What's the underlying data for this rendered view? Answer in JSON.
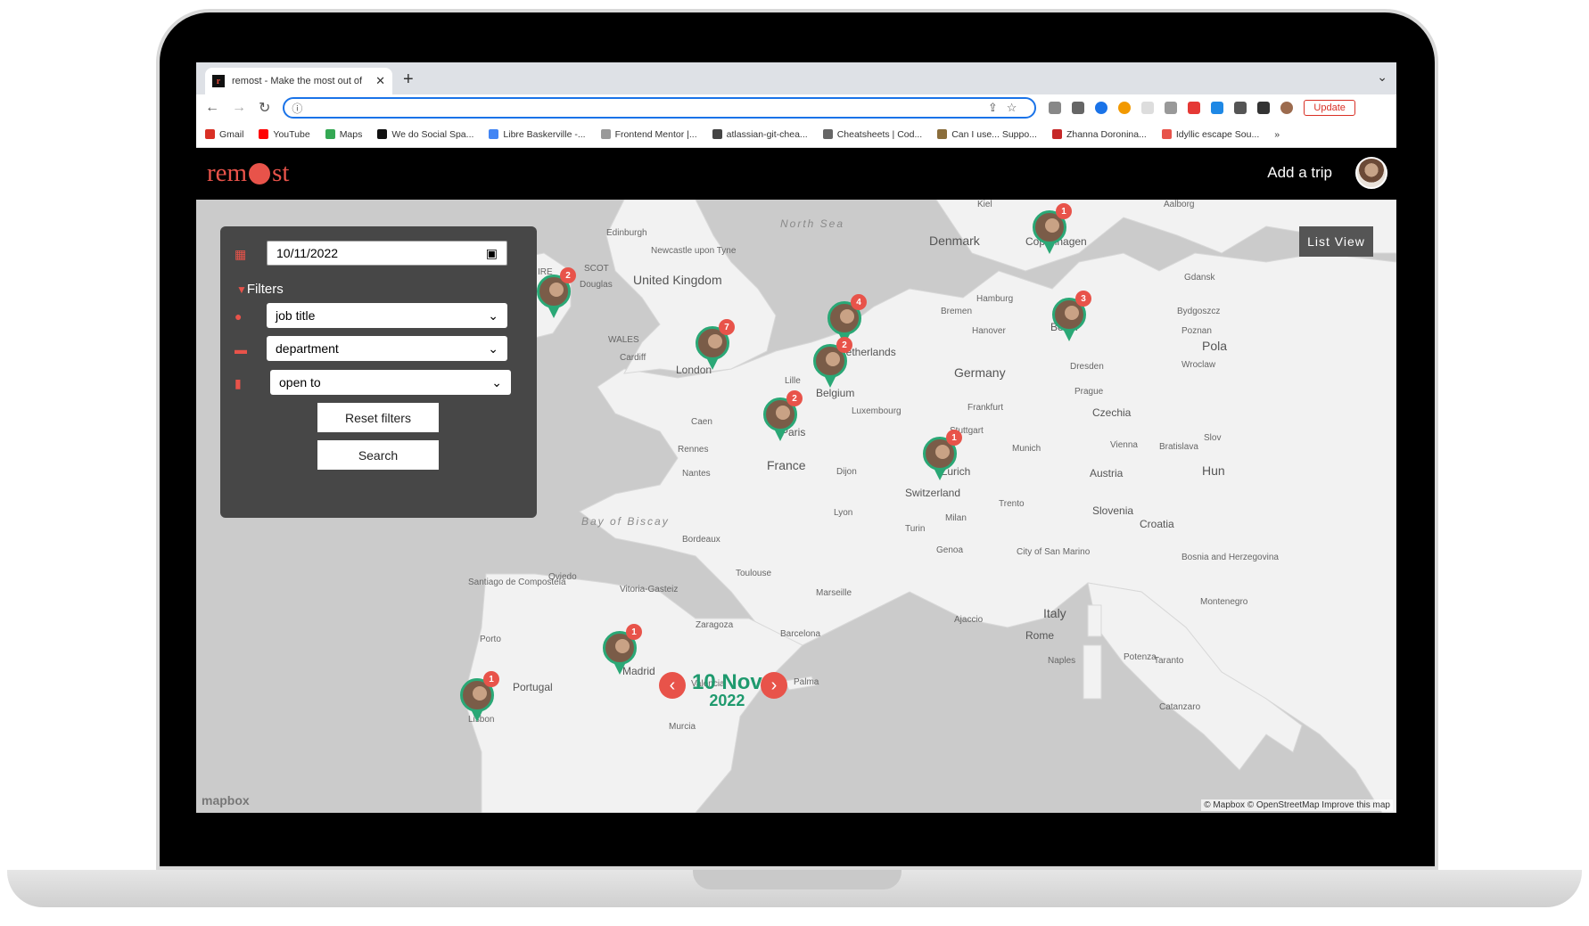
{
  "browser": {
    "tab_title": "remost - Make the most out of",
    "new_tab": "+",
    "update_label": "Update",
    "bookmarks": [
      "Gmail",
      "YouTube",
      "Maps",
      "We do Social Spa...",
      "Libre Baskerville -...",
      "Frontend Mentor |...",
      "atlassian-git-chea...",
      "Cheatsheets | Cod...",
      "Can I use... Suppo...",
      "Zhanna Doronina...",
      "Idyllic escape Sou..."
    ],
    "bookmark_colors": [
      "#d93025",
      "#ff0000",
      "#34a853",
      "#111111",
      "#4285f4",
      "#999999",
      "#444444",
      "#666666",
      "#8a6d3b",
      "#c62828",
      "#e8534a"
    ]
  },
  "app": {
    "logo_left": "rem",
    "logo_right": "st",
    "add_trip": "Add a trip",
    "list_view": "List View"
  },
  "filters": {
    "date_value": "10/11/2022",
    "heading": "Filters",
    "job_title": "job title",
    "department": "department",
    "open_to": "open to",
    "reset": "Reset filters",
    "search": "Search"
  },
  "map": {
    "labels": [
      {
        "t": "North Sea",
        "c": "sea"
      },
      {
        "t": "Denmark",
        "c": "big"
      },
      {
        "t": "United Kingdom",
        "c": "big"
      },
      {
        "t": "Ireland",
        "c": "big"
      },
      {
        "t": "Edinburgh",
        "c": "sm"
      },
      {
        "t": "Newcastle upon Tyne",
        "c": "sm"
      },
      {
        "t": "Douglas",
        "c": "sm"
      },
      {
        "t": "WALES",
        "c": "sm"
      },
      {
        "t": "Cardiff",
        "c": "sm"
      },
      {
        "t": "London",
        "c": ""
      },
      {
        "t": "Lille",
        "c": "sm"
      },
      {
        "t": "Belgium",
        "c": ""
      },
      {
        "t": "Luxembourg",
        "c": "sm"
      },
      {
        "t": "Paris",
        "c": ""
      },
      {
        "t": "Caen",
        "c": "sm"
      },
      {
        "t": "Rennes",
        "c": "sm"
      },
      {
        "t": "Nantes",
        "c": "sm"
      },
      {
        "t": "France",
        "c": "big"
      },
      {
        "t": "Dijon",
        "c": "sm"
      },
      {
        "t": "Lyon",
        "c": "sm"
      },
      {
        "t": "Bordeaux",
        "c": "sm"
      },
      {
        "t": "Toulouse",
        "c": "sm"
      },
      {
        "t": "Marseille",
        "c": "sm"
      },
      {
        "t": "Bay of Biscay",
        "c": "sea"
      },
      {
        "t": "Germany",
        "c": "big"
      },
      {
        "t": "Hamburg",
        "c": "sm"
      },
      {
        "t": "Bremen",
        "c": "sm"
      },
      {
        "t": "Hanover",
        "c": "sm"
      },
      {
        "t": "Berlin",
        "c": ""
      },
      {
        "t": "Frankfurt",
        "c": "sm"
      },
      {
        "t": "Stuttgart",
        "c": "sm"
      },
      {
        "t": "Munich",
        "c": "sm"
      },
      {
        "t": "Zurich",
        "c": ""
      },
      {
        "t": "Switzerland",
        "c": ""
      },
      {
        "t": "Dresden",
        "c": "sm"
      },
      {
        "t": "Prague",
        "c": "sm"
      },
      {
        "t": "Czechia",
        "c": ""
      },
      {
        "t": "Vienna",
        "c": "sm"
      },
      {
        "t": "Austria",
        "c": ""
      },
      {
        "t": "Bratislava",
        "c": "sm"
      },
      {
        "t": "Slovenia",
        "c": ""
      },
      {
        "t": "Croatia",
        "c": ""
      },
      {
        "t": "Trento",
        "c": "sm"
      },
      {
        "t": "Milan",
        "c": "sm"
      },
      {
        "t": "Turin",
        "c": "sm"
      },
      {
        "t": "Genoa",
        "c": "sm"
      },
      {
        "t": "Italy",
        "c": "big"
      },
      {
        "t": "Rome",
        "c": ""
      },
      {
        "t": "Naples",
        "c": "sm"
      },
      {
        "t": "Potenza",
        "c": "sm"
      },
      {
        "t": "Taranto",
        "c": "sm"
      },
      {
        "t": "Catanzaro",
        "c": "sm"
      },
      {
        "t": "Ajaccio",
        "c": "sm"
      },
      {
        "t": "City of San Marino",
        "c": "sm"
      },
      {
        "t": "Bosnia and Herzegovina",
        "c": "sm"
      },
      {
        "t": "Montenegro",
        "c": "sm"
      },
      {
        "t": "Kiel",
        "c": "sm"
      },
      {
        "t": "Gdansk",
        "c": "sm"
      },
      {
        "t": "Bydgoszcz",
        "c": "sm"
      },
      {
        "t": "Poznan",
        "c": "sm"
      },
      {
        "t": "Wroclaw",
        "c": "sm"
      },
      {
        "t": "Aalborg",
        "c": "sm"
      },
      {
        "t": "Santiago de Compostela",
        "c": "sm"
      },
      {
        "t": "Oviedo",
        "c": "sm"
      },
      {
        "t": "Vitoria-Gasteiz",
        "c": "sm"
      },
      {
        "t": "Zaragoza",
        "c": "sm"
      },
      {
        "t": "Barcelona",
        "c": "sm"
      },
      {
        "t": "Porto",
        "c": "sm"
      },
      {
        "t": "Madrid",
        "c": ""
      },
      {
        "t": "Valencia",
        "c": "sm"
      },
      {
        "t": "Palma",
        "c": "sm"
      },
      {
        "t": "Murcia",
        "c": "sm"
      },
      {
        "t": "Lisbon",
        "c": "sm"
      },
      {
        "t": "Portugal",
        "c": ""
      },
      {
        "t": "Netherlands",
        "c": ""
      },
      {
        "t": "Copenhagen",
        "c": ""
      },
      {
        "t": "SCOT",
        "c": "sm"
      },
      {
        "t": "N IRE",
        "c": "sm"
      },
      {
        "t": "Pola",
        "c": "big"
      },
      {
        "t": "Hun",
        "c": "big"
      },
      {
        "t": "Slov",
        "c": "sm"
      }
    ],
    "pins": [
      {
        "name": "Ireland",
        "count": "2"
      },
      {
        "name": "London",
        "count": "7"
      },
      {
        "name": "Netherlands",
        "count": "4"
      },
      {
        "name": "Belgium",
        "count": "2"
      },
      {
        "name": "Paris",
        "count": "2"
      },
      {
        "name": "Copenhagen",
        "count": "1"
      },
      {
        "name": "Berlin",
        "count": "3"
      },
      {
        "name": "Zurich",
        "count": "1"
      },
      {
        "name": "Madrid",
        "count": "1"
      },
      {
        "name": "Lisbon",
        "count": "1"
      }
    ],
    "date_day": "10 Nov",
    "date_year": "2022",
    "mapbox_logo": "mapbox",
    "attribution": "© Mapbox © OpenStreetMap Improve this map",
    "colors": {
      "land": "#f2f2f2",
      "water": "#cbcbcb",
      "accent": "#e8534a",
      "pin": "#2aa876"
    }
  }
}
